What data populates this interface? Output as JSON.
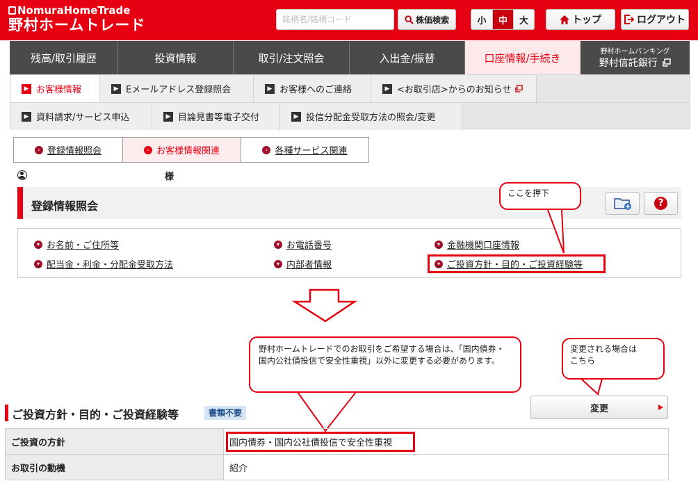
{
  "header": {
    "logo_en": "NomuraHomeTrade",
    "logo_ja": "野村ホームトレード",
    "search_placeholder": "銘柄名/銘柄コード",
    "search_button": "株価検索",
    "font_sizes": [
      "小",
      "中",
      "大"
    ],
    "font_size_selected": "中",
    "top_button": "トップ",
    "logout_button": "ログアウト"
  },
  "global_nav": {
    "items": [
      "残高/取引履歴",
      "投資情報",
      "取引/注文照会",
      "入出金/振替",
      "口座情報/手続き"
    ],
    "active": "口座情報/手続き",
    "bank_small": "野村ホームバンキング",
    "bank_large": "野村信託銀行"
  },
  "sub_nav": {
    "row1": [
      "お客様情報",
      "Eメールアドレス登録照会",
      "お客様へのご連絡",
      "<お取引店>からのお知らせ"
    ],
    "row2": [
      "資料請求/サービス申込",
      "目論見書等電子交付",
      "投信分配金受取方法の照会/変更"
    ],
    "active": "お客様情報"
  },
  "tabs": {
    "items": [
      "登録情報照会",
      "お客様情報関連",
      "各種サービス関連"
    ],
    "active": "お客様情報関連"
  },
  "user": {
    "suffix": "様"
  },
  "page": {
    "title": "登録情報照会",
    "links": [
      "お名前・ご住所等",
      "お電話番号",
      "金融機関口座情報",
      "配当金・利金・分配金受取方法",
      "内部者情報",
      "ご投資方針・目的・ご投資経験等"
    ]
  },
  "callouts": {
    "press_here": "ここを押下",
    "note": "野村ホームトレードでのお取引をご希望する場合は、「国内債券・国内公社債投信で安全性重視」以外に変更する必要があります。",
    "change_hint": "変更される場合は\nこちら"
  },
  "section": {
    "title": "ご投資方針・目的・ご投資経験等",
    "badge": "書類不要",
    "change_button": "変更",
    "rows": [
      {
        "label": "ご投資の方針",
        "value": "国内債券・国内公社債投信で安全性重視"
      },
      {
        "label": "お取引の動機",
        "value": "紹介"
      }
    ]
  },
  "colors": {
    "brand_red": "#e60012",
    "nav_dark": "#4a4a4a",
    "badge_blue": "#d6e5f3"
  }
}
